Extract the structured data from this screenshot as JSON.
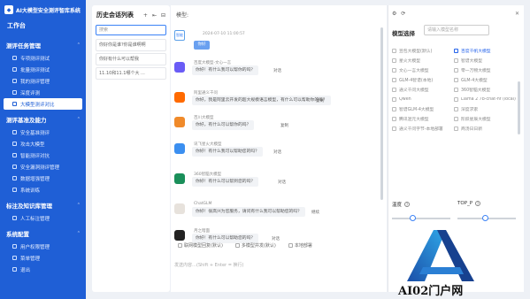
{
  "sidebar": {
    "brand": "AI大模型安全测评智库系统",
    "workbench": "工作台",
    "sections": [
      {
        "title": "测评任务管理",
        "items": [
          {
            "label": "专项测评测试"
          },
          {
            "label": "批量测评测试"
          },
          {
            "label": "我的测评管理"
          },
          {
            "label": "深度评测"
          },
          {
            "label": "大模型测评对比",
            "active": true
          }
        ]
      },
      {
        "title": "测评基准及能力",
        "items": [
          {
            "label": "安全基准测评"
          },
          {
            "label": "攻击大模型"
          },
          {
            "label": "智能测评对抗"
          },
          {
            "label": "安全漏洞测评管理"
          },
          {
            "label": "数据增强管理"
          },
          {
            "label": "系统训练"
          }
        ]
      },
      {
        "title": "标注及知识库管理",
        "items": [
          {
            "label": "人工标注管理"
          }
        ]
      },
      {
        "title": "系统配置",
        "items": [
          {
            "label": "用户权限管理"
          },
          {
            "label": "菜单管理"
          },
          {
            "label": "退出"
          }
        ]
      }
    ]
  },
  "chat_list": {
    "title": "历史会话列表",
    "search_placeholder": "搜索",
    "items": [
      "你好你是谁?你是谁啊啊",
      "你好有什么可以帮我",
      "11.10和11.1哪个大 ..."
    ]
  },
  "chat": {
    "mode_label": "模型:",
    "agent_badge": "智能",
    "time": "2024-07-10 11:00:57",
    "user_btn": "你好",
    "conversations": [
      {
        "name": "百度大模型-文心一言",
        "text": "你好！有什么我可以帮你的吗？",
        "action": "对话",
        "color": "#6a5cf6"
      },
      {
        "name": "阿里通义千问",
        "text": "你好，我是阿里云开发的超大规模语言模型，有什么可以帮助你的吗？",
        "action": "复制",
        "color": "#ff6a00"
      },
      {
        "name": "百川大模型",
        "text": "你好，有什么可以帮你的吗？",
        "action": "复制",
        "color": "#f08a2a"
      },
      {
        "name": "讯飞星火大模型",
        "text": "你好！有什么我可以帮助您的吗？",
        "action": "对话",
        "color": "#3b8ff0"
      },
      {
        "name": "360智脑大模型",
        "text": "你好！有什么可以帮到您的吗？",
        "action": "对话",
        "color": "#1a8f5a"
      },
      {
        "name": "ChatGLM",
        "text": "你好！很高兴为您服务，请问有什么我可以帮助您的吗？",
        "action": "继续",
        "color": "#e7e2dc"
      },
      {
        "name": "月之暗面",
        "text": "你好！有什么可以帮助您的吗？",
        "action": "对话",
        "color": "#222222"
      }
    ],
    "compare_opts": [
      "联网模型回复(默认)",
      "多模型并发(默认)",
      "本地部署"
    ],
    "input_hint": "发送内容…(Shift + Enter = 换行)"
  },
  "right_panel": {
    "icons": [
      "⚙",
      "⟳"
    ],
    "model_select_title": "模型选择",
    "model_search_placeholder": "请输入模型名称",
    "models": [
      [
        "豆包大模型(默认)",
        "百度千帆大模型"
      ],
      [
        "星火大模型",
        "智谱大模型"
      ],
      [
        "文心一言大模型",
        "零一万物大模型"
      ],
      [
        "GLM-4智谱(本地)",
        "GLM-4大模型"
      ],
      [
        "通义千问大模型",
        "360智脑大模型"
      ],
      [
        "Qwen",
        "Llama 2 7b-chat-hf (local)"
      ],
      [
        "智谱GLM-4大模型",
        "深度求索"
      ],
      [
        "腾讯混元大模型",
        "阶跃星辰大模型"
      ],
      [
        "通义千问字节-本地部署",
        "商汤日日新"
      ]
    ],
    "models_checked": [
      [
        false,
        true
      ],
      [
        false,
        false
      ],
      [
        false,
        false
      ],
      [
        false,
        false
      ],
      [
        false,
        false
      ],
      [
        false,
        false
      ],
      [
        false,
        false
      ],
      [
        false,
        false
      ],
      [
        false,
        false
      ]
    ],
    "param1": "温度",
    "param2": "TOP_P"
  },
  "watermark": "AI02门户网"
}
